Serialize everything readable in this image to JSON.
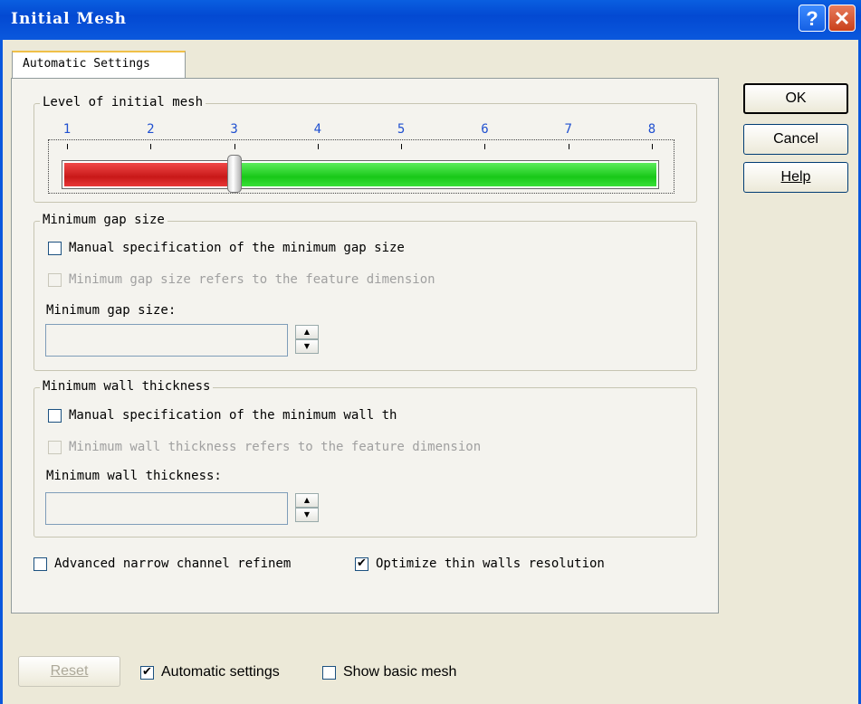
{
  "window": {
    "title": "Initial Mesh",
    "help_glyph": "?",
    "close_glyph": "✕",
    "accent_color": "#0a58dd"
  },
  "tab": {
    "label": "Automatic Settings"
  },
  "level_group": {
    "label": "Level of initial mesh",
    "ticks": [
      "1",
      "2",
      "3",
      "4",
      "5",
      "6",
      "7",
      "8"
    ],
    "value": 3,
    "min": 1,
    "max": 8,
    "low_color": "#d82020",
    "high_color": "#20d020"
  },
  "gap_group": {
    "label": "Minimum gap size",
    "manual_label": "Manual specification of the minimum gap size",
    "manual_checked": false,
    "refers_label": "Minimum gap size refers to the feature dimension",
    "refers_checked": false,
    "refers_enabled": false,
    "field_label": "Minimum gap size:",
    "field_value": ""
  },
  "wall_group": {
    "label": "Minimum wall thickness",
    "manual_label": "Manual specification of the minimum wall th",
    "manual_checked": false,
    "refers_label": "Minimum wall thickness refers to the feature dimension",
    "refers_checked": false,
    "refers_enabled": false,
    "field_label": "Minimum wall thickness:",
    "field_value": ""
  },
  "options": {
    "narrow_label": "Advanced narrow channel refinem",
    "narrow_checked": false,
    "thin_label": "Optimize thin walls resolution",
    "thin_checked": true
  },
  "buttons": {
    "ok": "OK",
    "cancel": "Cancel",
    "help": "Help",
    "reset": "Reset"
  },
  "footer": {
    "auto_label": "Automatic settings",
    "auto_checked": true,
    "basic_label": "Show basic mesh",
    "basic_checked": false
  }
}
